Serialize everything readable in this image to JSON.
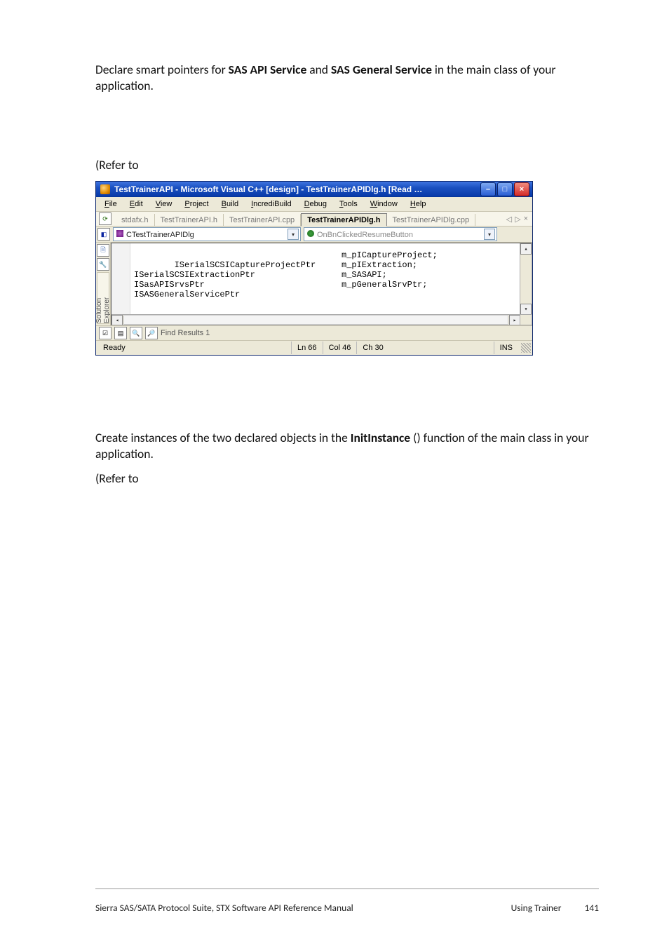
{
  "body": {
    "para1_pre": "Declare smart pointers for ",
    "para1_b1": "SAS API Service",
    "para1_mid": " and ",
    "para1_b2": "SAS General Service",
    "para1_post": " in the main class of your application.",
    "refer": "(Refer to",
    "para2_pre": "Create instances of the two declared objects in the ",
    "para2_b": "InitInstance",
    "para2_post": " () function of the main class in your application.",
    "refer2": "(Refer to"
  },
  "vs": {
    "title": "TestTrainerAPI - Microsoft Visual C++ [design] - TestTrainerAPIDlg.h [Read …",
    "menus": [
      "File",
      "Edit",
      "View",
      "Project",
      "Build",
      "IncrediBuild",
      "Debug",
      "Tools",
      "Window",
      "Help"
    ],
    "tabs": [
      "stdafx.h",
      "TestTrainerAPI.h",
      "TestTrainerAPI.cpp",
      "TestTrainerAPIDlg.h",
      "TestTrainerAPIDlg.cpp"
    ],
    "active_tab_index": 3,
    "combo_class": "CTestTrainerAPIDlg",
    "combo_member": "OnBnClickedResumeButton",
    "side_tab": "Solution Explorer",
    "code_left": "ISerialSCSICaptureProjectPtr\nISerialSCSIExtractionPtr\nISasAPISrvsPtr\nISASGeneralServicePtr",
    "code_right": "m_pICaptureProject;\nm_pIExtraction;\nm_SASAPI;\nm_pGeneralSrvPtr;",
    "find_label": "Find Results 1",
    "status": {
      "ready": "Ready",
      "ln": "Ln 66",
      "col": "Col 46",
      "ch": "Ch 30",
      "ins": "INS"
    }
  },
  "footer": {
    "left": "Sierra SAS/SATA Protocol Suite, STX Software API Reference Manual",
    "right_label": "Using Trainer",
    "page_no": "141"
  }
}
